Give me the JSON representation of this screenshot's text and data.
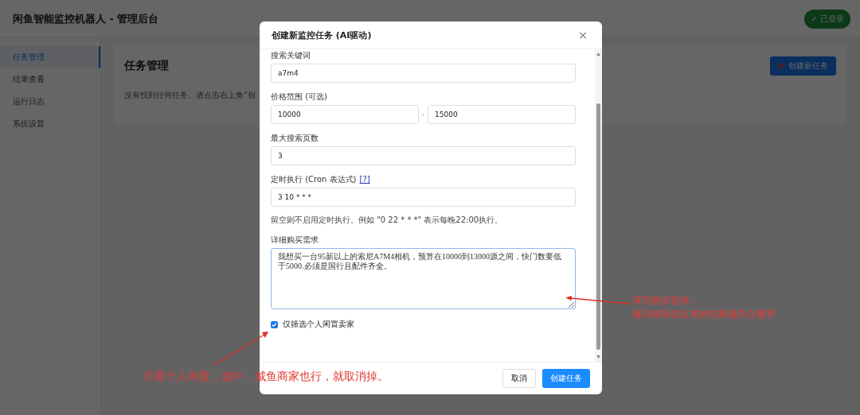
{
  "header": {
    "title": "闲鱼智能监控机器人 - 管理后台",
    "login_badge": "✓ 已登录"
  },
  "sidebar": {
    "items": [
      {
        "label": "任务管理",
        "selected": true
      },
      {
        "label": "结果查看",
        "selected": false
      },
      {
        "label": "运行日志",
        "selected": false
      },
      {
        "label": "系统设置",
        "selected": false
      }
    ]
  },
  "main": {
    "title": "任务管理",
    "empty_message": "没有找到任何任务。请点击右上角\"创",
    "create_button": "创建新任务"
  },
  "modal": {
    "title": "创建新监控任务 (AI驱动)",
    "close": "×",
    "fields": [
      {
        "kind": "text",
        "label": "搜索关键词",
        "value": "a7m4"
      },
      {
        "kind": "range",
        "label": "价格范围 (可选)",
        "min_value": "10000",
        "separator": "-",
        "max_value": "15000"
      },
      {
        "kind": "text",
        "label": "最大搜索页数",
        "value": "3"
      },
      {
        "kind": "text",
        "label": "定时执行 (Cron 表达式)",
        "help_link": "[?]",
        "value": "3 10 * * *",
        "hint": "留空则不启用定时执行。例如 \"0 22 * * *\" 表示每晚22:00执行。"
      },
      {
        "kind": "textarea",
        "label": "详细购买需求",
        "value": "我想买一台95新以上的索尼A7M4相机，预算在10000到13000源之间，快门数要低于5000.必须是国行且配件齐全。"
      }
    ],
    "checkbox": {
      "label": "仅筛选个人闲置卖家",
      "checked": true
    },
    "buttons": [
      {
        "label": "取消",
        "kind": "secondary"
      },
      {
        "label": "创建任务",
        "kind": "primary"
      }
    ]
  },
  "annotations": [
    {
      "lines": [
        "填写购买需求，",
        "越详细筛选出来的结果越符合要求"
      ]
    },
    {
      "lines": [
        "只看个人闲置，选中，咸鱼商家也行，就取消掉。"
      ]
    }
  ]
}
